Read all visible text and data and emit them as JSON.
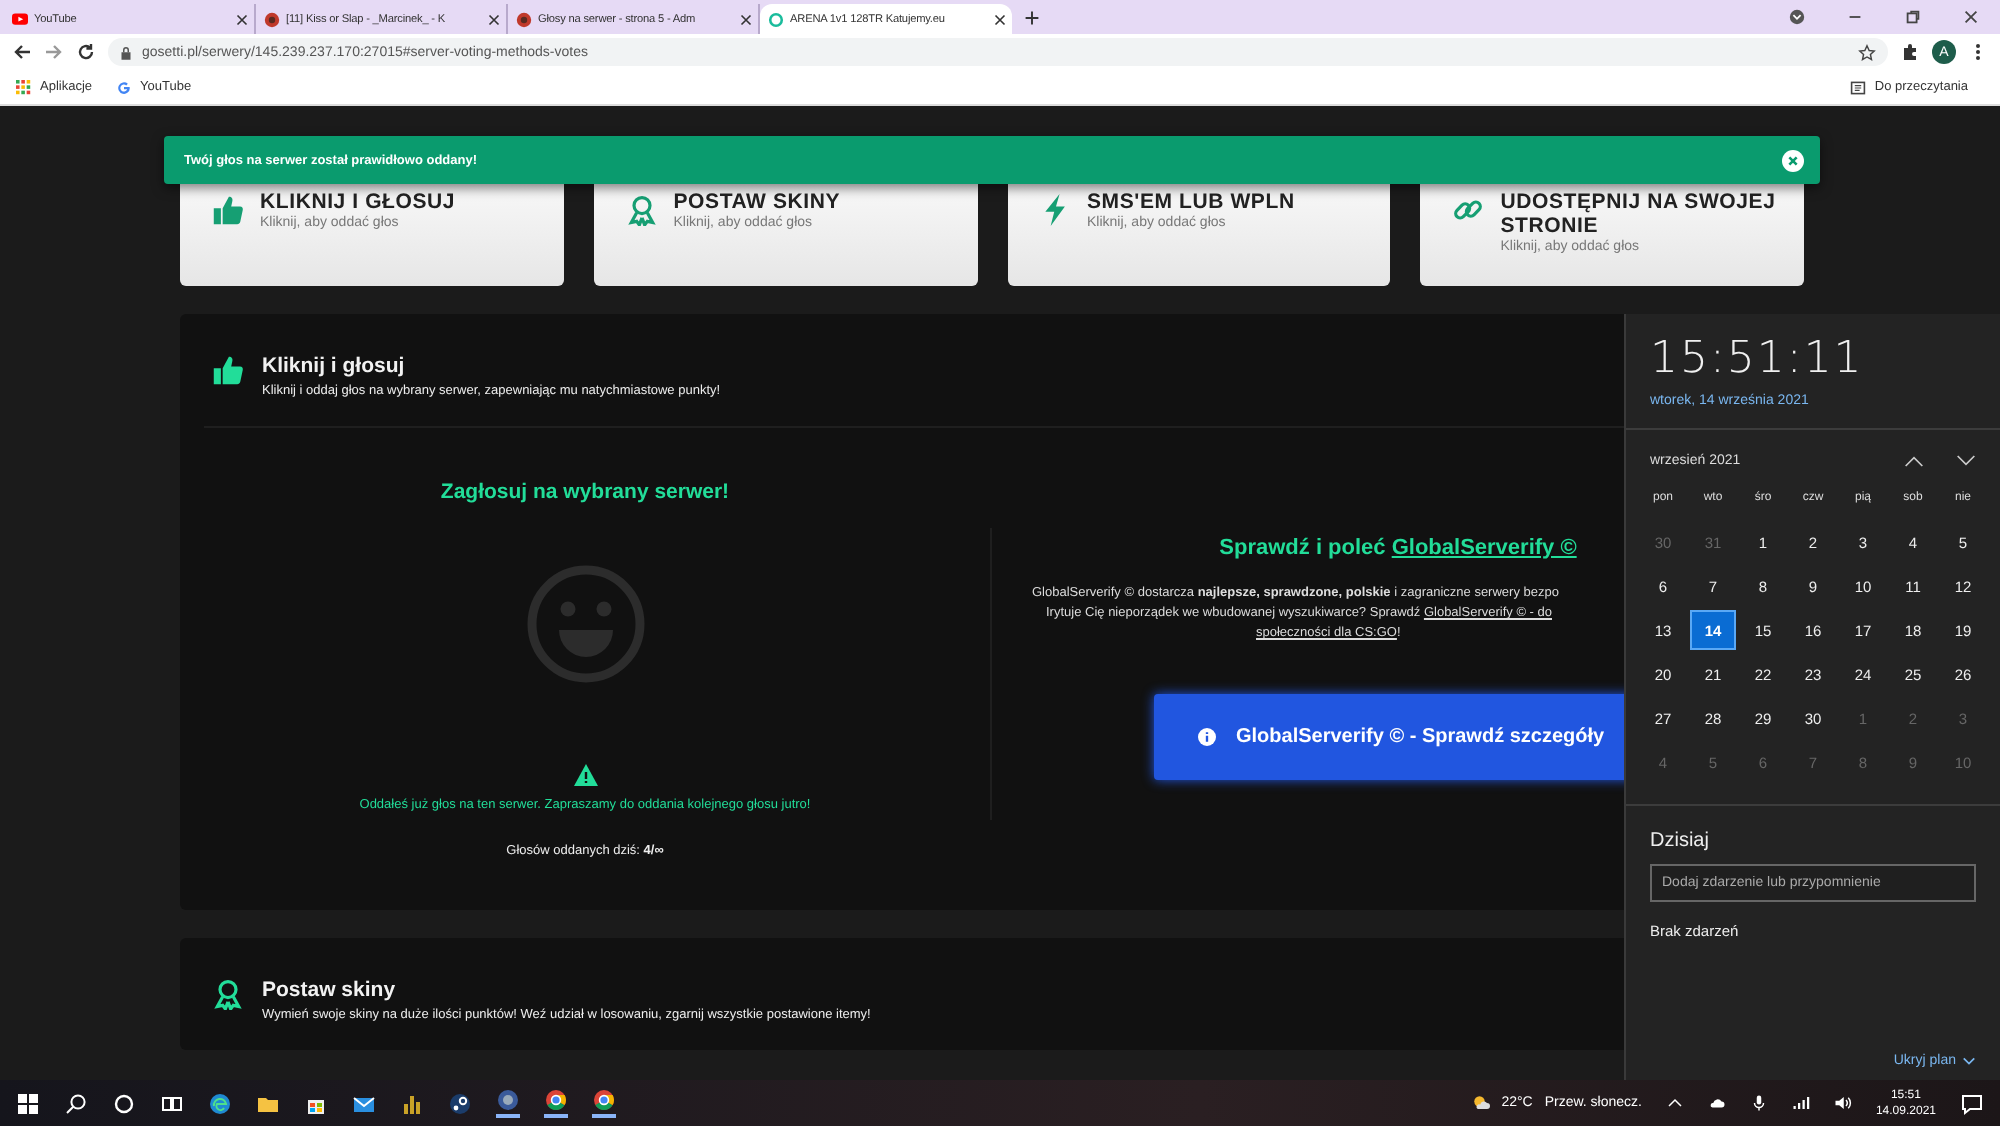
{
  "browser": {
    "tabs": [
      {
        "title": "YouTube",
        "selected": false
      },
      {
        "title": "[11] Kiss or Slap - _Marcinek_ - K",
        "selected": false
      },
      {
        "title": "Głosy na serwer - strona 5 - Adm",
        "selected": false
      },
      {
        "title": "ARENA 1v1 128TR Katujemy.eu",
        "selected": true
      }
    ],
    "address": "gosetti.pl/serwery/145.239.237.170:27015#server-voting-methods-votes",
    "profile_initial": "A",
    "bookmarks": [
      "Aplikacje",
      "YouTube"
    ],
    "reading_list": "Do przeczytania"
  },
  "notification": {
    "message": "Twój głos na serwer został prawidłowo oddany!"
  },
  "vote_methods": [
    {
      "title": "KLIKNIJ I GŁOSUJ",
      "subtitle": "Kliknij, aby oddać głos"
    },
    {
      "title": "POSTAW SKINY",
      "subtitle": "Kliknij, aby oddać głos"
    },
    {
      "title": "SMS'EM LUB WPLN",
      "subtitle": "Kliknij, aby oddać głos"
    },
    {
      "title": "UDOSTĘPNIJ NA SWOJEJ STRONIE",
      "subtitle": "Kliknij, aby oddać głos"
    }
  ],
  "sections": [
    {
      "title": "Kliknij i głosuj",
      "description": "Kliknij i oddaj głos na wybrany serwer, zapewniając mu natychmiastowe punkty!"
    },
    {
      "title": "Postaw skiny",
      "description": "Wymień swoje skiny na duże ilości punktów! Weź udział w losowaniu, zgarnij wszystkie postawione itemy!"
    }
  ],
  "vote_panel": {
    "heading": "Zagłosuj na wybrany serwer!",
    "notice": "Oddałeś już głos na ten serwer. Zapraszamy do oddania kolejnego głosu jutro!",
    "count": "Głosów oddanych dziś: **4/∞**"
  },
  "promo": {
    "heading": "Sprawdź i poleć",
    "heading_link": "GlobalServerify ©",
    "lines": [
      [
        {
          "kind": "text",
          "text": "GlobalServerify © dostarcza **najlepsze, sprawdzone, polskie** i zagraniczne serwery bezpo"
        }
      ],
      [
        {
          "kind": "text",
          "text": "Irytuje Cię nieporządek we wbudowanej wyszukiwarce? Sprawdź "
        },
        {
          "kind": "link",
          "text": "GlobalServerify © - do"
        }
      ],
      [
        {
          "kind": "link",
          "text": "społeczności dla CS:GO"
        },
        {
          "kind": "text",
          "text": "!"
        }
      ]
    ],
    "button": "GlobalServerify © - Sprawdź szczegóły"
  },
  "calendar": {
    "time": "15:51:11",
    "date": "wtorek, 14 września 2021",
    "month": "wrzesień 2021",
    "weekdays": [
      "pon",
      "wto",
      "śro",
      "czw",
      "pią",
      "sob",
      "nie"
    ],
    "weeks": [
      [
        {
          "day": "30",
          "muted": true,
          "selected": false
        },
        {
          "day": "31",
          "muted": true,
          "selected": false
        },
        {
          "day": "1",
          "muted": false,
          "selected": false
        },
        {
          "day": "2",
          "muted": false,
          "selected": false
        },
        {
          "day": "3",
          "muted": false,
          "selected": false
        },
        {
          "day": "4",
          "muted": false,
          "selected": false
        },
        {
          "day": "5",
          "muted": false,
          "selected": false
        }
      ],
      [
        {
          "day": "6",
          "muted": false,
          "selected": false
        },
        {
          "day": "7",
          "muted": false,
          "selected": false
        },
        {
          "day": "8",
          "muted": false,
          "selected": false
        },
        {
          "day": "9",
          "muted": false,
          "selected": false
        },
        {
          "day": "10",
          "muted": false,
          "selected": false
        },
        {
          "day": "11",
          "muted": false,
          "selected": false
        },
        {
          "day": "12",
          "muted": false,
          "selected": false
        }
      ],
      [
        {
          "day": "13",
          "muted": false,
          "selected": false
        },
        {
          "day": "14",
          "muted": false,
          "selected": true
        },
        {
          "day": "15",
          "muted": false,
          "selected": false
        },
        {
          "day": "16",
          "muted": false,
          "selected": false
        },
        {
          "day": "17",
          "muted": false,
          "selected": false
        },
        {
          "day": "18",
          "muted": false,
          "selected": false
        },
        {
          "day": "19",
          "muted": false,
          "selected": false
        }
      ],
      [
        {
          "day": "20",
          "muted": false,
          "selected": false
        },
        {
          "day": "21",
          "muted": false,
          "selected": false
        },
        {
          "day": "22",
          "muted": false,
          "selected": false
        },
        {
          "day": "23",
          "muted": false,
          "selected": false
        },
        {
          "day": "24",
          "muted": false,
          "selected": false
        },
        {
          "day": "25",
          "muted": false,
          "selected": false
        },
        {
          "day": "26",
          "muted": false,
          "selected": false
        }
      ],
      [
        {
          "day": "27",
          "muted": false,
          "selected": false
        },
        {
          "day": "28",
          "muted": false,
          "selected": false
        },
        {
          "day": "29",
          "muted": false,
          "selected": false
        },
        {
          "day": "30",
          "muted": false,
          "selected": false
        },
        {
          "day": "1",
          "muted": true,
          "selected": false
        },
        {
          "day": "2",
          "muted": true,
          "selected": false
        },
        {
          "day": "3",
          "muted": true,
          "selected": false
        }
      ],
      [
        {
          "day": "4",
          "muted": true,
          "selected": false
        },
        {
          "day": "5",
          "muted": true,
          "selected": false
        },
        {
          "day": "6",
          "muted": true,
          "selected": false
        },
        {
          "day": "7",
          "muted": true,
          "selected": false
        },
        {
          "day": "8",
          "muted": true,
          "selected": false
        },
        {
          "day": "9",
          "muted": true,
          "selected": false
        },
        {
          "day": "10",
          "muted": true,
          "selected": false
        }
      ]
    ],
    "today_label": "Dzisiaj",
    "event_placeholder": "Dodaj zdarzenie lub przypomnienie",
    "no_events": "Brak zdarzeń",
    "hide_link": "Ukryj plan"
  },
  "taskbar": {
    "temperature": "22°C",
    "weather": "Przew. słonecz.",
    "time": "15:51",
    "date": "14.09.2021"
  }
}
